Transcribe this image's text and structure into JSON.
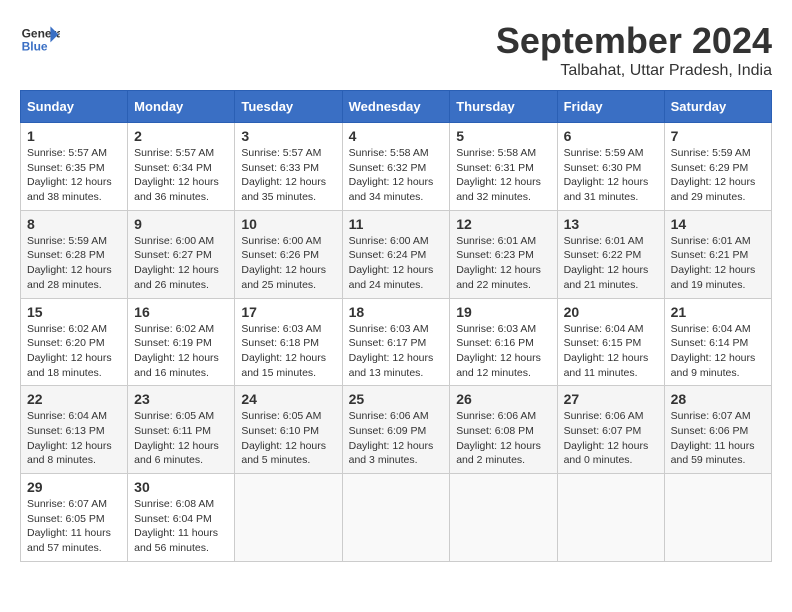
{
  "header": {
    "logo_line1": "General",
    "logo_line2": "Blue",
    "month_title": "September 2024",
    "location": "Talbahat, Uttar Pradesh, India"
  },
  "days_of_week": [
    "Sunday",
    "Monday",
    "Tuesday",
    "Wednesday",
    "Thursday",
    "Friday",
    "Saturday"
  ],
  "weeks": [
    [
      {
        "day": "1",
        "info": "Sunrise: 5:57 AM\nSunset: 6:35 PM\nDaylight: 12 hours\nand 38 minutes."
      },
      {
        "day": "2",
        "info": "Sunrise: 5:57 AM\nSunset: 6:34 PM\nDaylight: 12 hours\nand 36 minutes."
      },
      {
        "day": "3",
        "info": "Sunrise: 5:57 AM\nSunset: 6:33 PM\nDaylight: 12 hours\nand 35 minutes."
      },
      {
        "day": "4",
        "info": "Sunrise: 5:58 AM\nSunset: 6:32 PM\nDaylight: 12 hours\nand 34 minutes."
      },
      {
        "day": "5",
        "info": "Sunrise: 5:58 AM\nSunset: 6:31 PM\nDaylight: 12 hours\nand 32 minutes."
      },
      {
        "day": "6",
        "info": "Sunrise: 5:59 AM\nSunset: 6:30 PM\nDaylight: 12 hours\nand 31 minutes."
      },
      {
        "day": "7",
        "info": "Sunrise: 5:59 AM\nSunset: 6:29 PM\nDaylight: 12 hours\nand 29 minutes."
      }
    ],
    [
      {
        "day": "8",
        "info": "Sunrise: 5:59 AM\nSunset: 6:28 PM\nDaylight: 12 hours\nand 28 minutes."
      },
      {
        "day": "9",
        "info": "Sunrise: 6:00 AM\nSunset: 6:27 PM\nDaylight: 12 hours\nand 26 minutes."
      },
      {
        "day": "10",
        "info": "Sunrise: 6:00 AM\nSunset: 6:26 PM\nDaylight: 12 hours\nand 25 minutes."
      },
      {
        "day": "11",
        "info": "Sunrise: 6:00 AM\nSunset: 6:24 PM\nDaylight: 12 hours\nand 24 minutes."
      },
      {
        "day": "12",
        "info": "Sunrise: 6:01 AM\nSunset: 6:23 PM\nDaylight: 12 hours\nand 22 minutes."
      },
      {
        "day": "13",
        "info": "Sunrise: 6:01 AM\nSunset: 6:22 PM\nDaylight: 12 hours\nand 21 minutes."
      },
      {
        "day": "14",
        "info": "Sunrise: 6:01 AM\nSunset: 6:21 PM\nDaylight: 12 hours\nand 19 minutes."
      }
    ],
    [
      {
        "day": "15",
        "info": "Sunrise: 6:02 AM\nSunset: 6:20 PM\nDaylight: 12 hours\nand 18 minutes."
      },
      {
        "day": "16",
        "info": "Sunrise: 6:02 AM\nSunset: 6:19 PM\nDaylight: 12 hours\nand 16 minutes."
      },
      {
        "day": "17",
        "info": "Sunrise: 6:03 AM\nSunset: 6:18 PM\nDaylight: 12 hours\nand 15 minutes."
      },
      {
        "day": "18",
        "info": "Sunrise: 6:03 AM\nSunset: 6:17 PM\nDaylight: 12 hours\nand 13 minutes."
      },
      {
        "day": "19",
        "info": "Sunrise: 6:03 AM\nSunset: 6:16 PM\nDaylight: 12 hours\nand 12 minutes."
      },
      {
        "day": "20",
        "info": "Sunrise: 6:04 AM\nSunset: 6:15 PM\nDaylight: 12 hours\nand 11 minutes."
      },
      {
        "day": "21",
        "info": "Sunrise: 6:04 AM\nSunset: 6:14 PM\nDaylight: 12 hours\nand 9 minutes."
      }
    ],
    [
      {
        "day": "22",
        "info": "Sunrise: 6:04 AM\nSunset: 6:13 PM\nDaylight: 12 hours\nand 8 minutes."
      },
      {
        "day": "23",
        "info": "Sunrise: 6:05 AM\nSunset: 6:11 PM\nDaylight: 12 hours\nand 6 minutes."
      },
      {
        "day": "24",
        "info": "Sunrise: 6:05 AM\nSunset: 6:10 PM\nDaylight: 12 hours\nand 5 minutes."
      },
      {
        "day": "25",
        "info": "Sunrise: 6:06 AM\nSunset: 6:09 PM\nDaylight: 12 hours\nand 3 minutes."
      },
      {
        "day": "26",
        "info": "Sunrise: 6:06 AM\nSunset: 6:08 PM\nDaylight: 12 hours\nand 2 minutes."
      },
      {
        "day": "27",
        "info": "Sunrise: 6:06 AM\nSunset: 6:07 PM\nDaylight: 12 hours\nand 0 minutes."
      },
      {
        "day": "28",
        "info": "Sunrise: 6:07 AM\nSunset: 6:06 PM\nDaylight: 11 hours\nand 59 minutes."
      }
    ],
    [
      {
        "day": "29",
        "info": "Sunrise: 6:07 AM\nSunset: 6:05 PM\nDaylight: 11 hours\nand 57 minutes."
      },
      {
        "day": "30",
        "info": "Sunrise: 6:08 AM\nSunset: 6:04 PM\nDaylight: 11 hours\nand 56 minutes."
      },
      {
        "day": "",
        "info": ""
      },
      {
        "day": "",
        "info": ""
      },
      {
        "day": "",
        "info": ""
      },
      {
        "day": "",
        "info": ""
      },
      {
        "day": "",
        "info": ""
      }
    ]
  ]
}
